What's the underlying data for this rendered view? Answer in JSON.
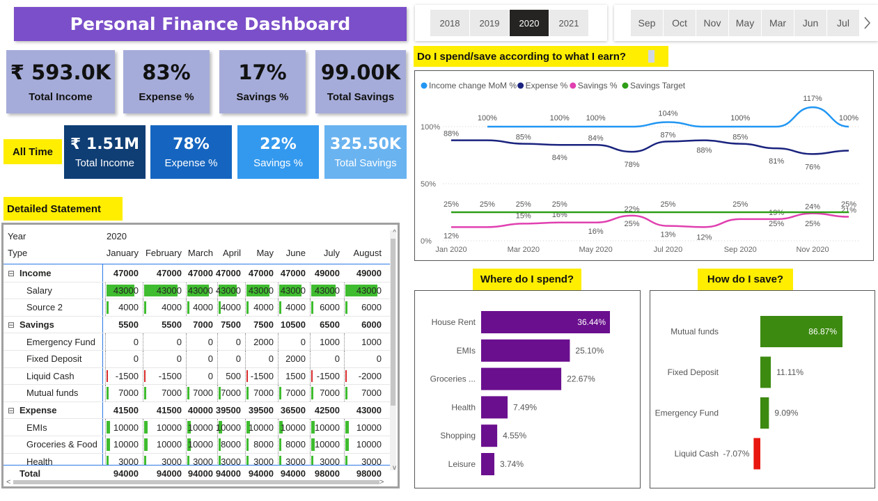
{
  "title": "Personal Finance Dashboard",
  "kpis_top": [
    {
      "value": "₹ 593.0K",
      "label": "Total Income"
    },
    {
      "value": "83%",
      "label": "Expense %"
    },
    {
      "value": "17%",
      "label": "Savings %"
    },
    {
      "value": "99.00K",
      "label": "Total Savings"
    }
  ],
  "all_time_label": "All Time",
  "kpis_all_time": [
    {
      "value": "₹ 1.51M",
      "label": "Total Income",
      "color": "#0f3e75"
    },
    {
      "value": "78%",
      "label": "Expense %",
      "color": "#1565c0"
    },
    {
      "value": "22%",
      "label": "Savings %",
      "color": "#3399ee"
    },
    {
      "value": "325.50K",
      "label": "Total Savings",
      "color": "#69b3f0"
    }
  ],
  "years": [
    {
      "label": "2018",
      "selected": false
    },
    {
      "label": "2019",
      "selected": false
    },
    {
      "label": "2020",
      "selected": true
    },
    {
      "label": "2021",
      "selected": false
    }
  ],
  "months": [
    "Sep",
    "Oct",
    "Nov",
    "May",
    "Mar",
    "Jun",
    "Jul"
  ],
  "month_next_icon": "chevron-right-icon",
  "detailed_statement_title": "Detailed Statement",
  "matrix": {
    "year_label": "Year",
    "year_value": "2020",
    "type_label": "Type",
    "months": [
      "January",
      "February",
      "March",
      "April",
      "May",
      "June",
      "July",
      "August"
    ],
    "rows": [
      {
        "label": "Income",
        "level": 0,
        "bold": true,
        "expand": "⊟",
        "values": [
          "47000",
          "47000",
          "47000",
          "47000",
          "47000",
          "47000",
          "49000",
          "49000"
        ]
      },
      {
        "label": "Salary",
        "level": 1,
        "bar": "green-full",
        "values": [
          "43000",
          "43000",
          "43000",
          "43000",
          "43000",
          "43000",
          "43000",
          "43000"
        ]
      },
      {
        "label": "Source 2",
        "level": 1,
        "bar": "green-thin",
        "values": [
          "4000",
          "4000",
          "4000",
          "4000",
          "4000",
          "4000",
          "6000",
          "6000"
        ]
      },
      {
        "label": "Savings",
        "level": 0,
        "bold": true,
        "expand": "⊟",
        "values": [
          "5500",
          "5500",
          "7000",
          "7500",
          "7500",
          "10500",
          "6500",
          "6000"
        ]
      },
      {
        "label": "Emergency Fund",
        "level": 1,
        "bar": "none",
        "values": [
          "0",
          "0",
          "0",
          "0",
          "2000",
          "0",
          "1000",
          "1000"
        ]
      },
      {
        "label": "Fixed Deposit",
        "level": 1,
        "bar": "none",
        "values": [
          "0",
          "0",
          "0",
          "0",
          "0",
          "2000",
          "0",
          "0"
        ]
      },
      {
        "label": "Liquid Cash",
        "level": 1,
        "bar": "red",
        "values": [
          "-1500",
          "-1500",
          "0",
          "500",
          "-1500",
          "1500",
          "-1500",
          "-2000"
        ]
      },
      {
        "label": "Mutual funds",
        "level": 1,
        "bar": "green-thin",
        "values": [
          "7000",
          "7000",
          "7000",
          "7000",
          "7000",
          "7000",
          "7000",
          "7000"
        ]
      },
      {
        "label": "Expense",
        "level": 0,
        "bold": true,
        "expand": "⊟",
        "values": [
          "41500",
          "41500",
          "40000",
          "39500",
          "39500",
          "36500",
          "42500",
          "43000"
        ]
      },
      {
        "label": "EMIs",
        "level": 1,
        "bar": "green-thin",
        "values": [
          "10000",
          "10000",
          "10000",
          "10000",
          "10000",
          "10000",
          "10000",
          "10000"
        ]
      },
      {
        "label": "Groceries & Food",
        "level": 1,
        "bar": "green-thin",
        "values": [
          "10000",
          "10000",
          "10000",
          "8000",
          "8000",
          "8000",
          "10000",
          "10000"
        ]
      },
      {
        "label": "Health",
        "level": 1,
        "bar": "green-thin",
        "values": [
          "3000",
          "3000",
          "3000",
          "3000",
          "3000",
          "3000",
          "3000",
          "3000"
        ]
      }
    ],
    "total": {
      "label": "Total",
      "values": [
        "94000",
        "94000",
        "94000",
        "94000",
        "94000",
        "94000",
        "98000",
        "98000"
      ]
    }
  },
  "line_chart_title": "Do I spend/save according to what I earn?",
  "chart_data": [
    {
      "type": "line",
      "title": "Do I spend/save according to what I earn?",
      "x": [
        "Jan 2020",
        "Feb 2020",
        "Mar 2020",
        "Apr 2020",
        "May 2020",
        "Jun 2020",
        "Jul 2020",
        "Aug 2020",
        "Sep 2020",
        "Oct 2020",
        "Nov 2020",
        "Dec 2020"
      ],
      "x_tick_labels": [
        "Jan 2020",
        "Mar 2020",
        "May 2020",
        "Jul 2020",
        "Sep 2020",
        "Nov 2020"
      ],
      "y_ticks": [
        "0%",
        "50%",
        "100%"
      ],
      "ylim": [
        0,
        1.2
      ],
      "legend_position": "top-left",
      "series": [
        {
          "name": "Income change MoM %",
          "color": "#2196f3",
          "values": [
            null,
            1.0,
            1.0,
            1.0,
            1.0,
            1.0,
            1.04,
            1.0,
            1.0,
            1.0,
            1.17,
            1.0
          ],
          "labels": [
            "",
            "100%",
            "",
            "100%",
            "100%",
            "",
            "104%",
            "",
            "100%",
            "",
            "117%",
            "100%"
          ]
        },
        {
          "name": "Expense %",
          "color": "#1a237e",
          "values": [
            0.88,
            0.88,
            0.85,
            0.84,
            0.84,
            0.78,
            0.87,
            0.88,
            0.85,
            0.81,
            0.76,
            0.79
          ],
          "labels": [
            "88%",
            "",
            "85%",
            "84%",
            "84%",
            "78%",
            "87%",
            "88%",
            "85%",
            "81%",
            "76%",
            ""
          ]
        },
        {
          "name": "Savings %",
          "color": "#e040b0",
          "values": [
            0.12,
            0.12,
            0.15,
            0.16,
            0.16,
            0.22,
            0.13,
            0.12,
            0.19,
            0.19,
            0.24,
            0.21
          ],
          "labels": [
            "12%",
            "",
            "15%",
            "16%",
            "16%",
            "22%",
            "13%",
            "12%",
            "",
            "19%",
            "24%",
            "21%"
          ]
        },
        {
          "name": "Savings Target",
          "color": "#2e9e16",
          "values": [
            0.25,
            0.25,
            0.25,
            0.25,
            0.25,
            0.25,
            0.25,
            0.25,
            0.25,
            0.25,
            0.25,
            0.25
          ],
          "labels": [
            "25%",
            "25%",
            "25%",
            "25%",
            "",
            "25%",
            "25%",
            "",
            "25%",
            "25%",
            "25%",
            "25%"
          ]
        }
      ]
    },
    {
      "type": "bar",
      "title": "Where do I spend?",
      "orientation": "horizontal",
      "categories": [
        "House Rent",
        "EMIs",
        "Groceries ...",
        "Health",
        "Shopping",
        "Leisure"
      ],
      "values": [
        36.44,
        25.1,
        22.67,
        7.49,
        4.55,
        3.74
      ],
      "value_labels": [
        "36.44%",
        "25.10%",
        "22.67%",
        "7.49%",
        "4.55%",
        "3.74%"
      ],
      "color": "#6a0f8e"
    },
    {
      "type": "bar",
      "title": "How do I save?",
      "orientation": "horizontal",
      "categories": [
        "Mutual funds",
        "Fixed Deposit",
        "Emergency Fund",
        "Liquid Cash"
      ],
      "values": [
        86.87,
        11.11,
        9.09,
        -7.07
      ],
      "value_labels": [
        "86.87%",
        "11.11%",
        "9.09%",
        "-7.07%"
      ],
      "colors": [
        "#3c8a10",
        "#3c8a10",
        "#3c8a10",
        "#e8170f"
      ]
    }
  ],
  "spend_title": "Where do I spend?",
  "save_title": "How do I save?"
}
